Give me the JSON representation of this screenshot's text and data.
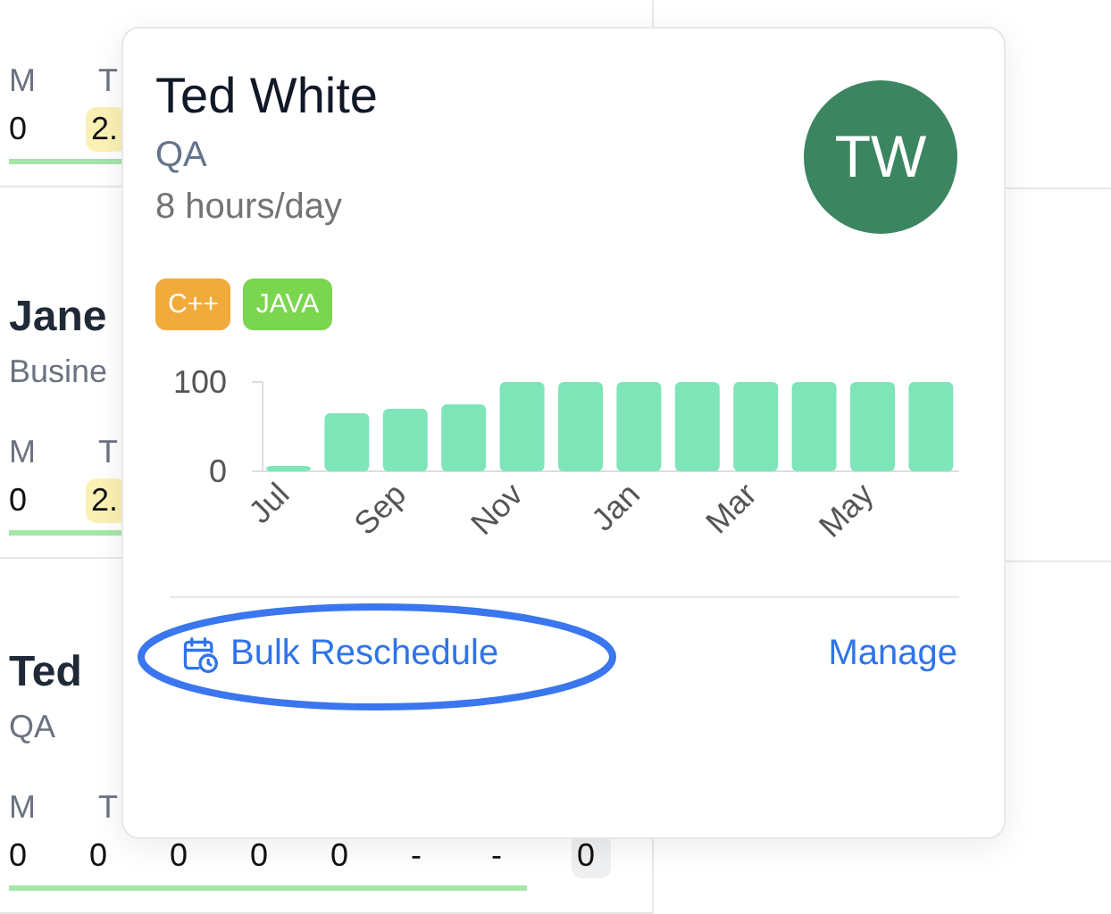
{
  "background_rows": [
    {
      "name": "",
      "role": "",
      "days": [
        "M",
        "T"
      ],
      "values": [
        {
          "text": "0",
          "kind": "plain"
        },
        {
          "text": "2.",
          "kind": "warning"
        }
      ]
    },
    {
      "name": "Jane",
      "role": "Busine",
      "days": [
        "M",
        "T"
      ],
      "values": [
        {
          "text": "0",
          "kind": "plain"
        },
        {
          "text": "2.",
          "kind": "warning"
        }
      ]
    },
    {
      "name": "Ted",
      "role": "QA",
      "days": [
        "M",
        "T"
      ],
      "values": [
        {
          "text": "0",
          "kind": "plain"
        },
        {
          "text": "0",
          "kind": "plain"
        },
        {
          "text": "0",
          "kind": "plain"
        },
        {
          "text": "0",
          "kind": "plain"
        },
        {
          "text": "0",
          "kind": "plain"
        },
        {
          "text": "-",
          "kind": "plain"
        },
        {
          "text": "-",
          "kind": "plain"
        },
        {
          "text": "0",
          "kind": "muted"
        }
      ]
    }
  ],
  "popover": {
    "name": "Ted White",
    "role": "QA",
    "hours": "8 hours/day",
    "avatar": {
      "initials": "TW",
      "color": "#3b8560"
    },
    "tags": [
      {
        "label": "C++",
        "color": "#f0ab3c"
      },
      {
        "label": "JAVA",
        "color": "#7ad64f"
      }
    ],
    "chart_data": {
      "type": "bar",
      "categories": [
        "Jul",
        null,
        "Sep",
        null,
        "Nov",
        null,
        "Jan",
        null,
        "Mar",
        null,
        "May",
        null
      ],
      "series": [
        {
          "color": "#7ee5b9",
          "values": [
            5,
            65,
            70,
            75,
            100,
            100,
            100,
            100,
            100,
            100,
            100,
            100
          ]
        }
      ],
      "ylim": [
        0,
        100
      ],
      "yticks": [
        0,
        100
      ]
    },
    "actions": [
      {
        "label": "Bulk Reschedule",
        "kind": "icon-link",
        "circled": true
      },
      {
        "label": "Manage",
        "kind": "link",
        "circled": false
      }
    ]
  }
}
